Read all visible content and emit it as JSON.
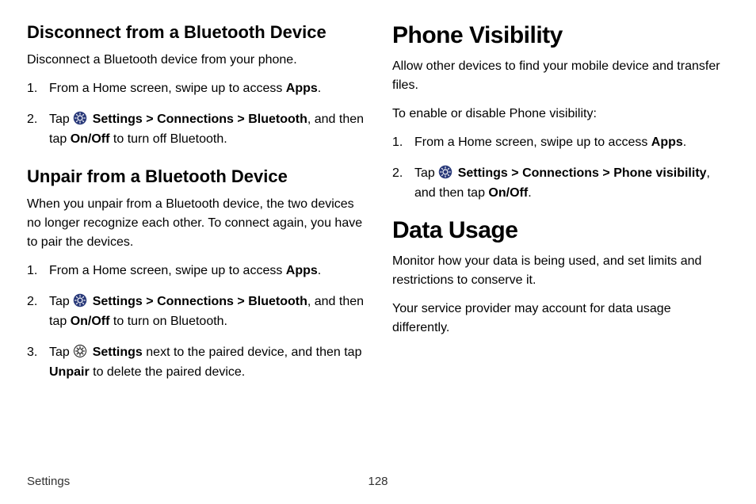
{
  "left": {
    "section1": {
      "heading": "Disconnect from a Bluetooth Device",
      "intro": "Disconnect a Bluetooth device from your phone.",
      "steps": [
        {
          "pre": "From a Home screen, swipe up to access ",
          "bold1": "Apps",
          "post1": "."
        },
        {
          "pre": "Tap ",
          "icon": "settings-filled",
          "bold1": "Settings",
          "sep1": " > ",
          "bold2": "Connections",
          "sep2": " > ",
          "bold3": "Bluetooth",
          "post1": ", and then tap ",
          "bold4": "On/Off",
          "post2": " to turn off Bluetooth."
        }
      ]
    },
    "section2": {
      "heading": "Unpair from a Bluetooth Device",
      "intro": "When you unpair from a Bluetooth device, the two devices no longer recognize each other. To connect again, you have to pair the devices.",
      "steps": [
        {
          "pre": "From a Home screen, swipe up to access ",
          "bold1": "Apps",
          "post1": "."
        },
        {
          "pre": "Tap ",
          "icon": "settings-filled",
          "bold1": "Settings",
          "sep1": " > ",
          "bold2": "Connections",
          "sep2": " > ",
          "bold3": "Bluetooth",
          "post1": ", and then tap ",
          "bold4": "On/Off",
          "post2": " to turn on Bluetooth."
        },
        {
          "pre": "Tap ",
          "icon": "settings-outline",
          "bold1": "Settings",
          "post1": " next to the paired device, and then tap ",
          "bold2": "Unpair",
          "post2": " to delete the paired device."
        }
      ]
    }
  },
  "right": {
    "section1": {
      "heading": "Phone Visibility",
      "intro": "Allow other devices to find your mobile device and transfer files.",
      "subintro": "To enable or disable Phone visibility:",
      "steps": [
        {
          "pre": "From a Home screen, swipe up to access ",
          "bold1": "Apps",
          "post1": "."
        },
        {
          "pre": "Tap ",
          "icon": "settings-filled",
          "bold1": "Settings",
          "sep1": " > ",
          "bold2": "Connections",
          "sep2": " > ",
          "bold3": "Phone visibility",
          "post1": ", and then tap ",
          "bold4": "On/Off",
          "post2": "."
        }
      ]
    },
    "section2": {
      "heading": "Data Usage",
      "intro": "Monitor how your data is being used, and set limits and restrictions to conserve it.",
      "subintro": "Your service provider may account for data usage differently."
    }
  },
  "footer": {
    "section": "Settings",
    "page": "128"
  }
}
